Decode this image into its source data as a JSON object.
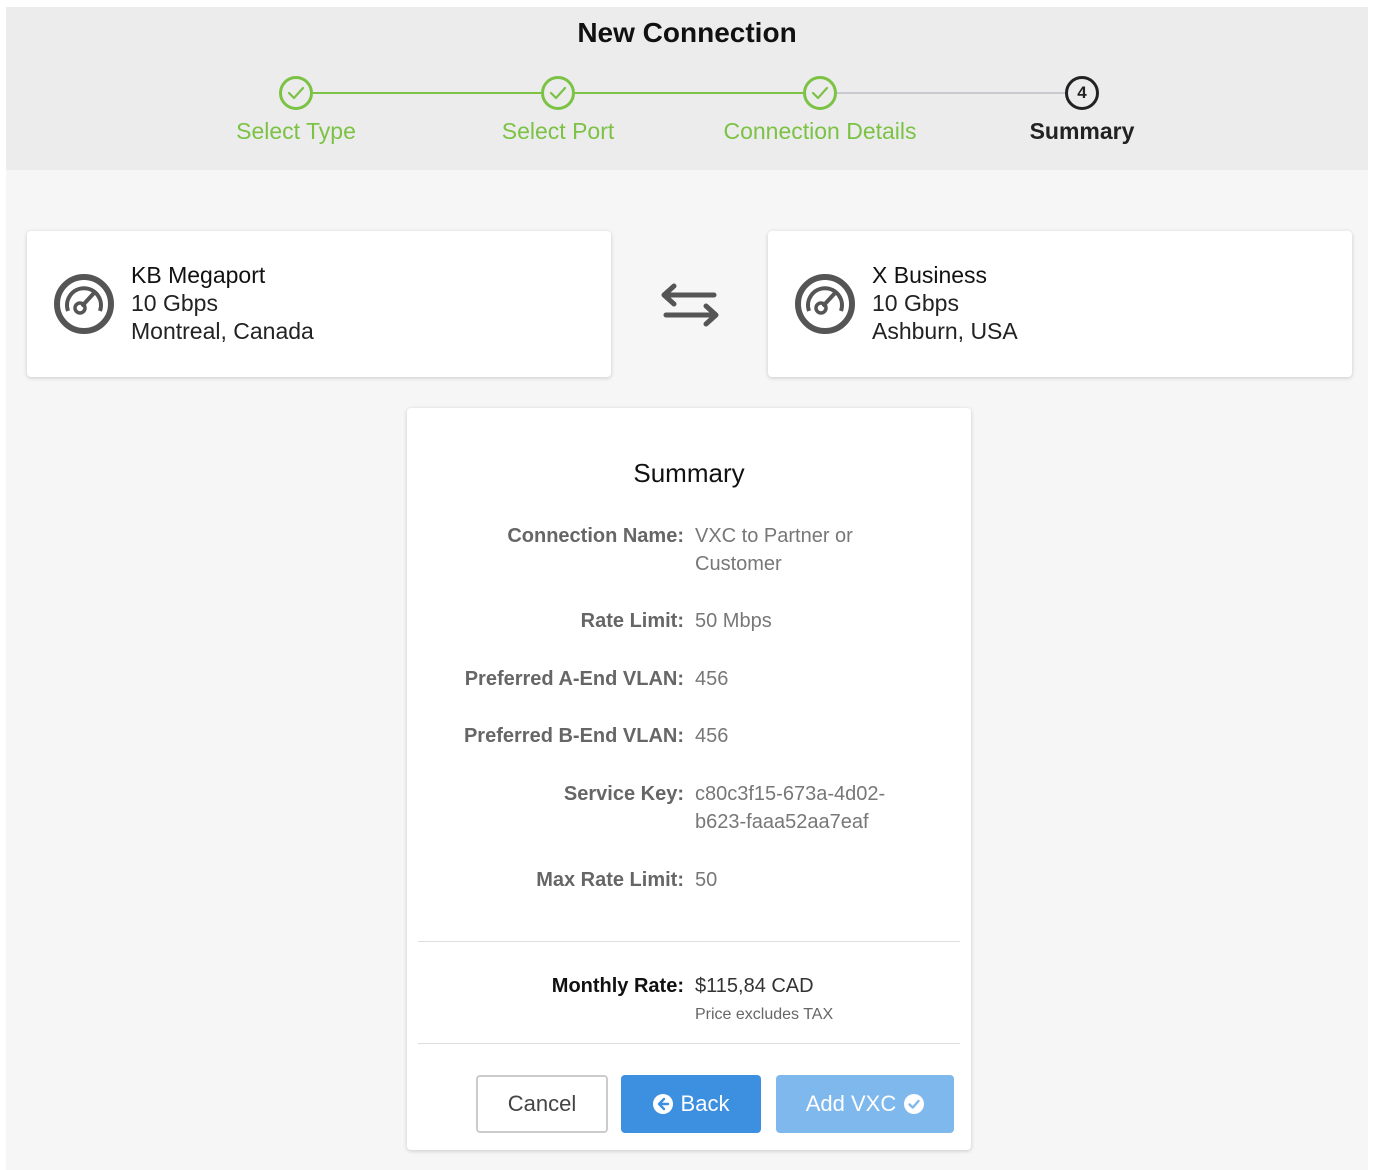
{
  "page": {
    "title": "New Connection"
  },
  "stepper": {
    "steps": [
      {
        "label": "Select Type",
        "state": "done"
      },
      {
        "label": "Select Port",
        "state": "done"
      },
      {
        "label": "Connection Details",
        "state": "done"
      },
      {
        "label": "Summary",
        "state": "current",
        "number": "4"
      }
    ],
    "done_color": "#7cc245",
    "pending_line_color": "#c9c9d0"
  },
  "a_end": {
    "name": "KB Megaport",
    "speed": "10 Gbps",
    "location": "Montreal, Canada",
    "icon": "gauge-icon"
  },
  "b_end": {
    "name": "X Business",
    "speed": "10 Gbps",
    "location": "Ashburn, USA",
    "icon": "gauge-icon"
  },
  "swap_icon": "swap-arrows-icon",
  "summary": {
    "title": "Summary",
    "fields": {
      "connection_name": {
        "label": "Connection Name:",
        "value_line1": "VXC to Partner or",
        "value_line2": "Customer"
      },
      "rate_limit": {
        "label": "Rate Limit:",
        "value": "50 Mbps"
      },
      "a_vlan": {
        "label": "Preferred A-End VLAN:",
        "value": "456"
      },
      "b_vlan": {
        "label": "Preferred B-End VLAN:",
        "value": "456"
      },
      "service_key": {
        "label": "Service Key:",
        "value_line1": "c80c3f15-673a-4d02-",
        "value_line2": "b623-faaa52aa7eaf"
      },
      "max_rate_limit": {
        "label": "Max Rate Limit:",
        "value": "50"
      }
    },
    "monthly_rate": {
      "label": "Monthly Rate:",
      "value": "$115,84 CAD",
      "note": "Price excludes TAX"
    }
  },
  "buttons": {
    "cancel": "Cancel",
    "back": "Back",
    "add": "Add VXC",
    "primary_color": "#3d8fe0",
    "disabled_color": "#7fb8ec"
  }
}
